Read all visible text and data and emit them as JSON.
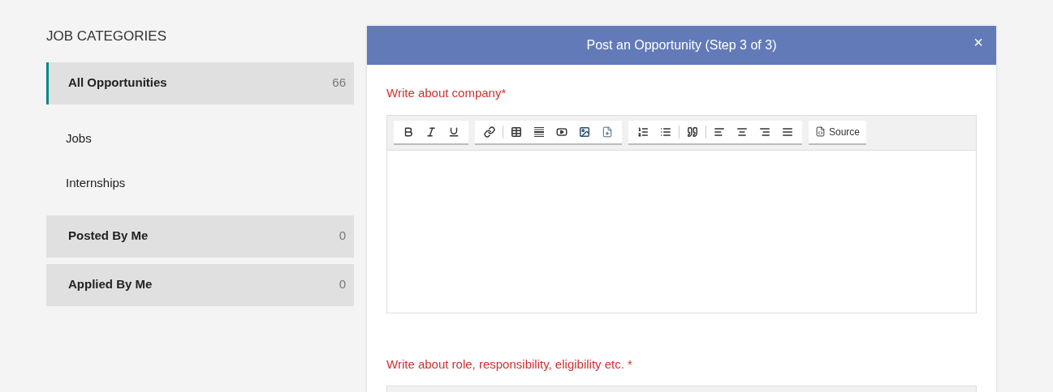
{
  "sidebar": {
    "heading": "JOB CATEGORIES",
    "items": [
      {
        "kind": "card",
        "label": "All Opportunities",
        "count": "66",
        "selected": true
      },
      {
        "kind": "plain",
        "label": "Jobs",
        "selected": false
      },
      {
        "kind": "plain",
        "label": "Internships",
        "selected": false
      },
      {
        "kind": "card",
        "label": "Posted By Me",
        "count": "0",
        "selected": false
      },
      {
        "kind": "card",
        "label": "Applied By Me",
        "count": "0",
        "selected": false
      }
    ]
  },
  "modal": {
    "title": "Post an Opportunity (Step 3 of 3)",
    "close": "×",
    "editors": [
      {
        "label": "Write about company*",
        "source_button": "Source"
      },
      {
        "label": "Write about role, responsibility, eligibility etc. *"
      }
    ]
  }
}
